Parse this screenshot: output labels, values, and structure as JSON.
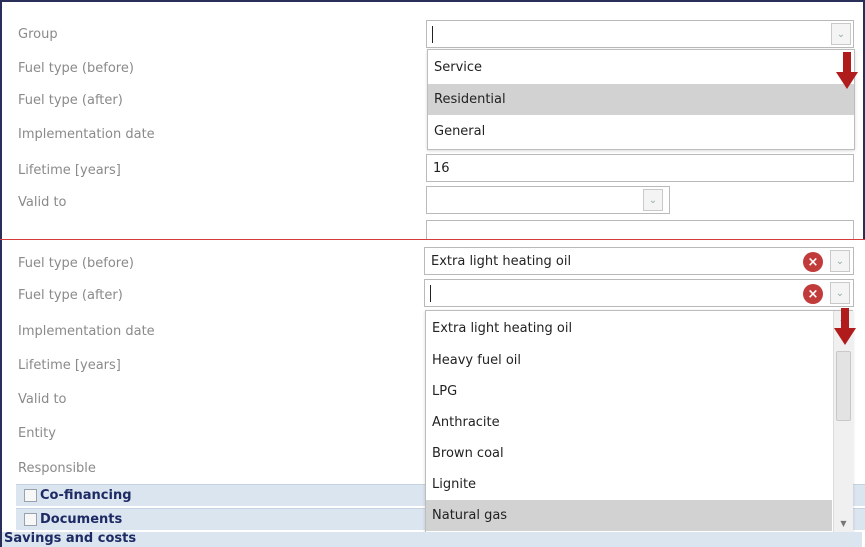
{
  "top_form": {
    "group_label": "Group",
    "fuel_before_label": "Fuel type (before)",
    "fuel_after_label": "Fuel type (after)",
    "implementation_date_label": "Implementation date",
    "lifetime_label": "Lifetime [years]",
    "lifetime_value": "16",
    "valid_to_label": "Valid to",
    "group_options": [
      {
        "label": "Service",
        "selected": false
      },
      {
        "label": "Residential",
        "selected": true
      },
      {
        "label": "General",
        "selected": false
      }
    ]
  },
  "bottom_form": {
    "fuel_before_label": "Fuel type (before)",
    "fuel_before_value": "Extra light heating oil",
    "fuel_after_label": "Fuel type (after)",
    "implementation_date_label": "Implementation date",
    "lifetime_label": "Lifetime [years]",
    "valid_to_label": "Valid to",
    "entity_label": "Entity",
    "responsible_label": "Responsible",
    "fuel_options": [
      {
        "label": "Extra light heating oil",
        "selected": false
      },
      {
        "label": "Heavy fuel oil",
        "selected": false
      },
      {
        "label": "LPG",
        "selected": false
      },
      {
        "label": "Anthracite",
        "selected": false
      },
      {
        "label": "Brown coal",
        "selected": false
      },
      {
        "label": "Lignite",
        "selected": false
      },
      {
        "label": "Natural gas",
        "selected": true
      }
    ]
  },
  "sections": {
    "co_financing": "Co-financing",
    "documents": "Documents",
    "savings_and_costs": "Savings and costs"
  },
  "icons": {
    "dropdown": "chevron-down-icon",
    "clear": "clear-icon",
    "pointer": "arrow-down-icon"
  },
  "colors": {
    "highlight_arrow": "#b01c1c",
    "clear_button": "#c23b3b",
    "section_bar": "#dbe5ef",
    "section_text": "#1d2a63",
    "divider": "#d73a3a"
  }
}
